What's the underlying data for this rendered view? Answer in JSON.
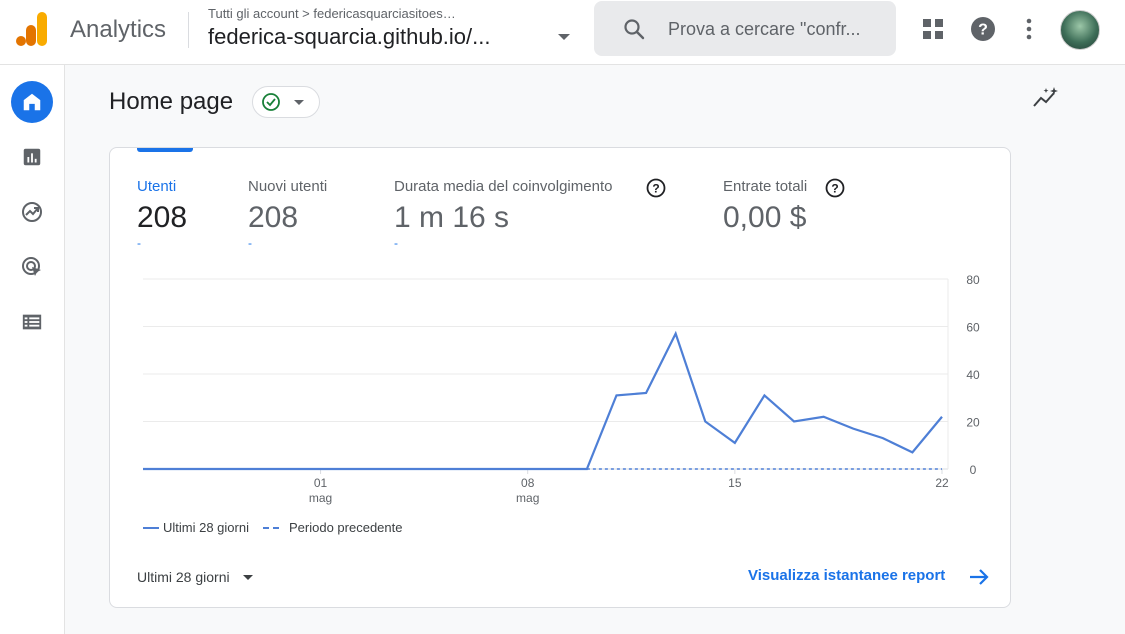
{
  "app": {
    "brand": "Analytics"
  },
  "account": {
    "path": "Tutti gli account > federicasquarciasitoes…",
    "property": "federica-squarcia.github.io/..."
  },
  "search": {
    "placeholder": "Prova a cercare \"confr..."
  },
  "page": {
    "title": "Home page"
  },
  "metrics": [
    {
      "label": "Utenti",
      "value": "208",
      "delta": "-",
      "active": true
    },
    {
      "label": "Nuovi utenti",
      "value": "208",
      "delta": "-"
    },
    {
      "label": "Durata media del coinvolgimento",
      "value": "1 m 16 s",
      "delta": "-",
      "help": true
    },
    {
      "label": "Entrate totali",
      "value": "0,00 $",
      "help": true
    }
  ],
  "chart_data": {
    "type": "line",
    "x_labels": [
      {
        "day": "01",
        "month": "mag",
        "index": 6
      },
      {
        "day": "08",
        "month": "mag",
        "index": 13
      },
      {
        "day": "15",
        "month": "",
        "index": 20
      },
      {
        "day": "22",
        "month": "",
        "index": 27
      }
    ],
    "y_ticks": [
      0,
      20,
      40,
      60,
      80
    ],
    "ylim": [
      0,
      80
    ],
    "series": [
      {
        "name": "Ultimi 28 giorni",
        "style": "solid",
        "color": "#4e7fd6",
        "values": [
          0,
          0,
          0,
          0,
          0,
          0,
          0,
          0,
          0,
          0,
          0,
          0,
          0,
          0,
          0,
          0,
          31,
          32,
          57,
          20,
          11,
          31,
          20,
          22,
          17,
          13,
          7,
          22
        ]
      },
      {
        "name": "Periodo precedente",
        "style": "dashed",
        "color": "#4e7fd6",
        "values": [
          0,
          0,
          0,
          0,
          0,
          0,
          0,
          0,
          0,
          0,
          0,
          0,
          0,
          0,
          0,
          0,
          0,
          0,
          0,
          0,
          0,
          0,
          0,
          0,
          0,
          0,
          0,
          0
        ]
      }
    ]
  },
  "footer": {
    "range_label": "Ultimi 28 giorni",
    "report_link": "Visualizza istantanee report"
  },
  "colors": {
    "accent": "#1a73e8",
    "line": "#4e7fd6",
    "logo_orange": "#f9ab00",
    "logo_dark": "#e37400"
  }
}
